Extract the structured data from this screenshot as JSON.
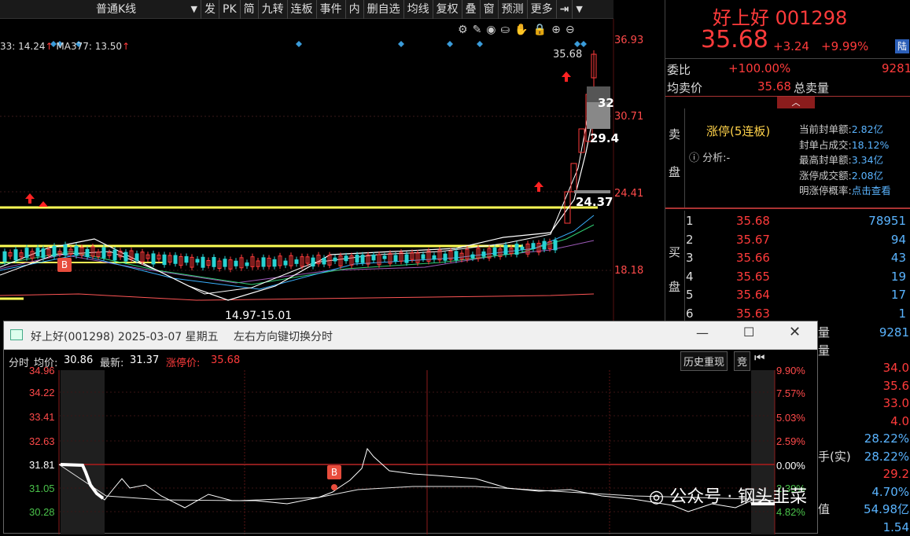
{
  "toolbar": {
    "items": [
      "普通K线",
      "发",
      "PK",
      "简",
      "九转",
      "连板",
      "事件",
      "内",
      "删自选",
      "均线",
      "复权",
      "叠",
      "窗",
      "预测",
      "更多"
    ],
    "dropdown_arrow": "chevron-down-icon"
  },
  "kline": {
    "ma_text_1": "33: 14.24",
    "ma_arrow_1": "↑",
    "ma_text_2": "MA377: 13.50",
    "ma_arrow_2": "↑",
    "price_axis": [
      "36.93",
      "30.71",
      "24.41",
      "18.18"
    ],
    "annot_high": "35.68",
    "annot_32": "32",
    "annot_29": "29.4",
    "annot_2437": "24.37",
    "annot_low": "14.97-15.01",
    "b_marker": "B",
    "colors": {
      "up": "#ff3b3b",
      "down": "#29d3d3",
      "yellow": "#ffff55",
      "bg": "#000000"
    }
  },
  "right": {
    "name": "好上好 001298",
    "price": "35.68",
    "change": "+3.24",
    "change_pct": "+9.99%",
    "badge": "陆",
    "weibi_label": "委比",
    "weibi_value": "+100.00%",
    "weibi_extra": "9281",
    "avg_label": "均卖价",
    "avg_value": "35.68",
    "total_sell_label": "总卖量",
    "sell_label_1": "卖",
    "sell_label_2": "盘",
    "zt_title": "涨停(5连板)",
    "analysis_label": "分析:-",
    "zt_rows": [
      {
        "label": "当前封单额:",
        "value": "2.82亿"
      },
      {
        "label": "封单占成交:",
        "value": "18.12%"
      },
      {
        "label": "最高封单额:",
        "value": "3.34亿"
      },
      {
        "label": "涨停成交额:",
        "value": "2.08亿"
      },
      {
        "label": "明涨停概率:",
        "value": "点击查看"
      }
    ],
    "buy_label_1": "买",
    "buy_label_2": "盘",
    "buy_rows": [
      {
        "level": "1",
        "price": "35.68",
        "vol": "78951"
      },
      {
        "level": "2",
        "price": "35.67",
        "vol": "94"
      },
      {
        "level": "3",
        "price": "35.66",
        "vol": "43"
      },
      {
        "level": "4",
        "price": "35.65",
        "vol": "19"
      },
      {
        "level": "5",
        "price": "35.64",
        "vol": "17"
      },
      {
        "level": "6",
        "price": "35.63",
        "vol": "1"
      }
    ],
    "under_popup": [
      {
        "l": "量",
        "v": "9281"
      },
      {
        "l": "量",
        "v": ""
      },
      {
        "l": "",
        "v": "34.0"
      },
      {
        "l": "",
        "v": "35.6"
      },
      {
        "l": "",
        "v": "33.0"
      },
      {
        "l": "",
        "v": "4.0"
      },
      {
        "l": "",
        "v": "28.22%"
      },
      {
        "l": "手(实)",
        "v": "28.22%"
      },
      {
        "l": "",
        "v": "29.2"
      },
      {
        "l": "",
        "v": "4.70%"
      },
      {
        "l": "值",
        "v": "54.98亿"
      },
      {
        "l": "",
        "v": "1.54"
      }
    ]
  },
  "popup": {
    "title": "好上好(001298) 2025-03-07 星期五",
    "hint": "左右方向键切换分时",
    "bar_label": "分时",
    "avg_label": "均价:",
    "avg_value": "30.86",
    "last_label": "最新:",
    "last_value": "31.37",
    "limit_label": "涨停价:",
    "limit_value": "35.68",
    "history_btn": "历史重现",
    "jing_btn": "竞",
    "left_ticks": [
      "34.96",
      "34.22",
      "33.41",
      "32.63",
      "31.81",
      "31.05",
      "30.28"
    ],
    "right_ticks": [
      "9.90%",
      "7.57%",
      "5.03%",
      "2.59%",
      "0.00%",
      "2.39%",
      "4.82%"
    ],
    "b_marker": "B",
    "watermark": "公众号 · 钢头韭菜"
  }
}
